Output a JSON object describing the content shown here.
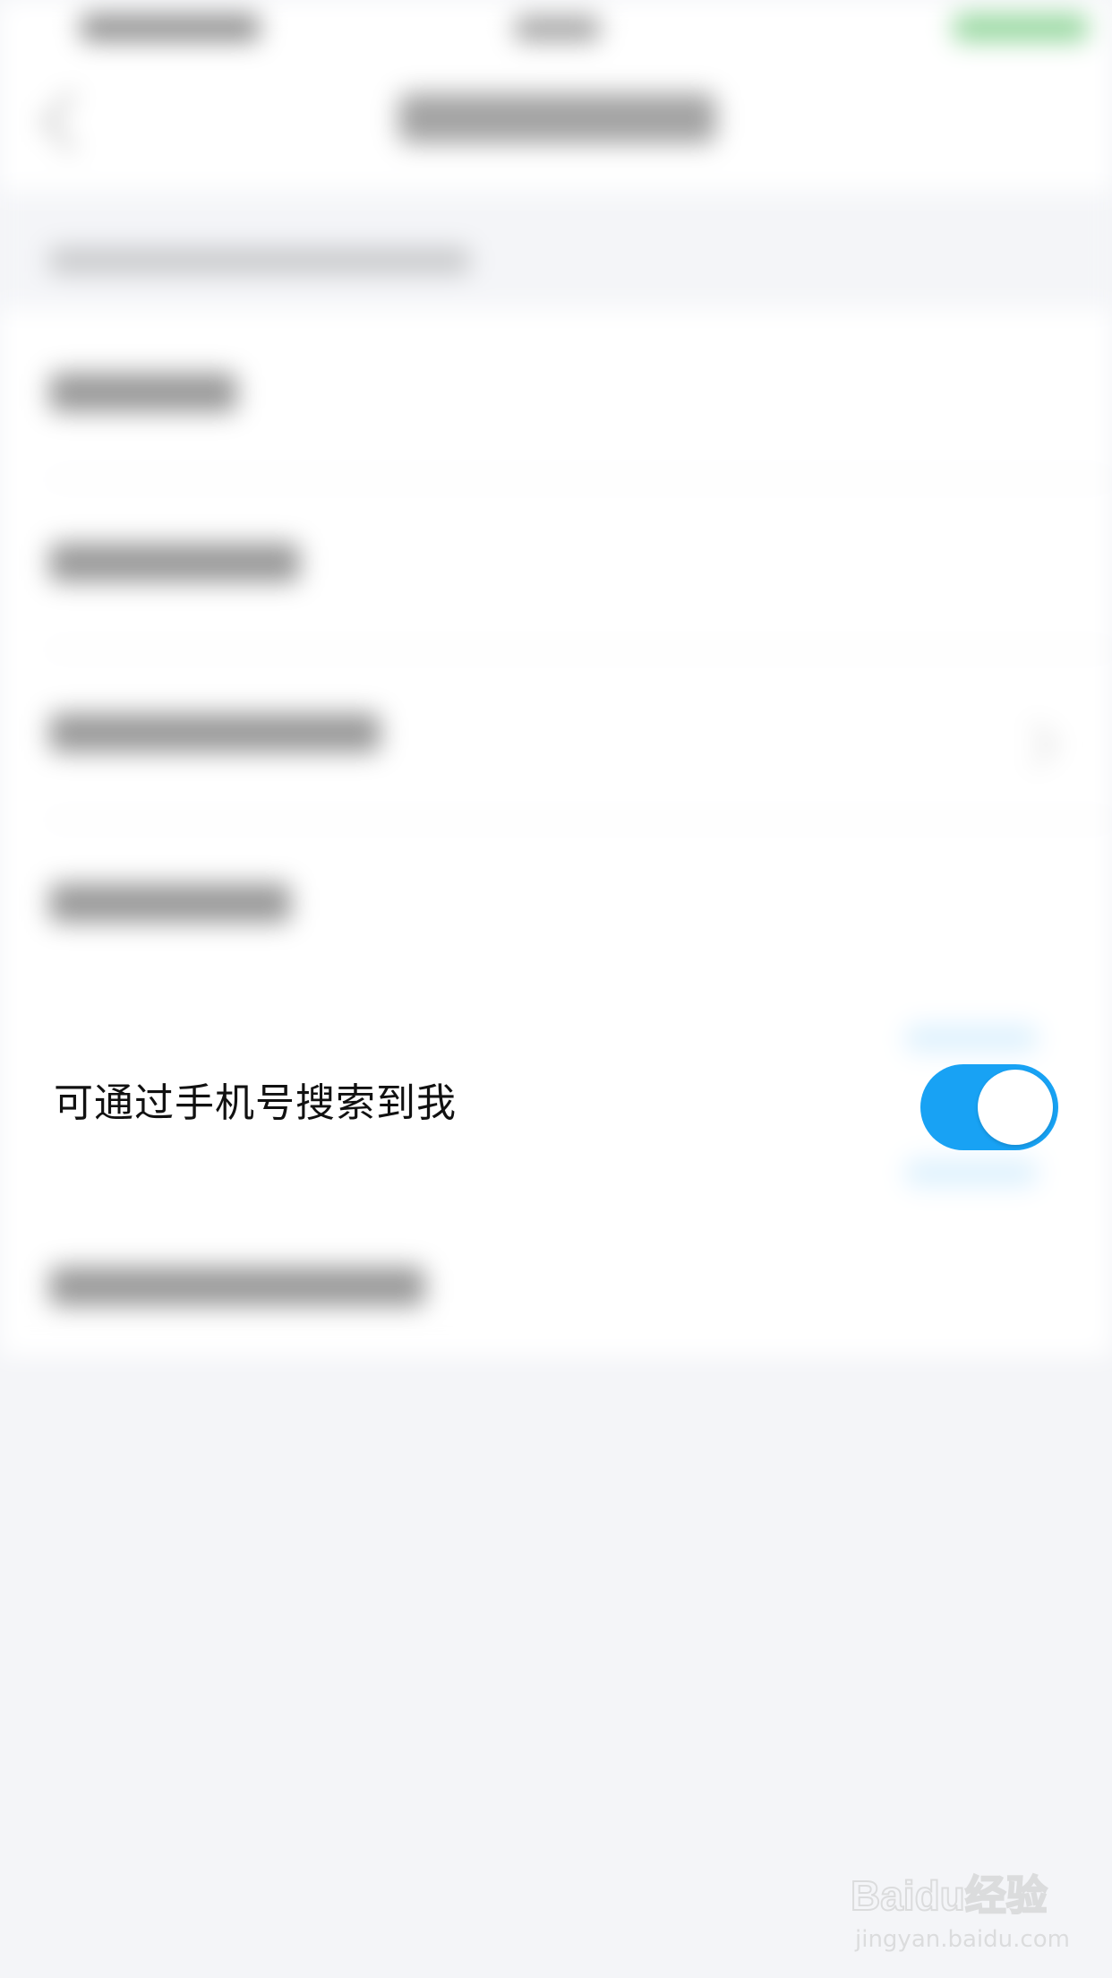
{
  "settings": {
    "phone_search_label": "可通过手机号搜索到我",
    "phone_search_enabled": true
  },
  "colors": {
    "accent": "#18a2f4",
    "background": "#f4f5f8",
    "text": "#111111"
  },
  "watermark": {
    "brand": "Baidu经验",
    "url": "jingyan.baidu.com"
  }
}
